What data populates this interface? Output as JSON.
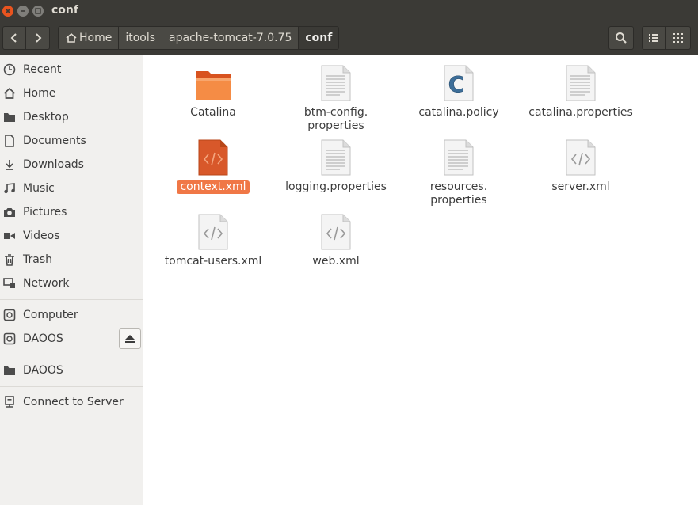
{
  "window": {
    "title": "conf"
  },
  "toolbar": {
    "breadcrumbs": [
      "Home",
      "itools",
      "apache-tomcat-7.0.75",
      "conf"
    ]
  },
  "sidebar": {
    "items": [
      {
        "label": "Recent",
        "icon": "clock-icon"
      },
      {
        "label": "Home",
        "icon": "home-icon"
      },
      {
        "label": "Desktop",
        "icon": "folder-icon"
      },
      {
        "label": "Documents",
        "icon": "document-icon"
      },
      {
        "label": "Downloads",
        "icon": "download-icon"
      },
      {
        "label": "Music",
        "icon": "music-icon"
      },
      {
        "label": "Pictures",
        "icon": "camera-icon"
      },
      {
        "label": "Videos",
        "icon": "video-icon"
      },
      {
        "label": "Trash",
        "icon": "trash-icon"
      },
      {
        "label": "Network",
        "icon": "network-icon"
      },
      {
        "label": "Computer",
        "icon": "drive-icon"
      },
      {
        "label": "DAOOS",
        "icon": "drive-icon"
      },
      {
        "label": "DAOOS",
        "icon": "folder-icon"
      },
      {
        "label": "Connect to Server",
        "icon": "server-icon"
      }
    ]
  },
  "files": [
    {
      "name": "Catalina",
      "type": "folder"
    },
    {
      "name": "btm-config.\nproperties",
      "type": "text"
    },
    {
      "name": "catalina.policy",
      "type": "policy"
    },
    {
      "name": "catalina.properties",
      "type": "text"
    },
    {
      "name": "context.xml",
      "type": "xml-selected"
    },
    {
      "name": "logging.properties",
      "type": "text"
    },
    {
      "name": "resources.\nproperties",
      "type": "text"
    },
    {
      "name": "server.xml",
      "type": "xml"
    },
    {
      "name": "tomcat-users.xml",
      "type": "xml"
    },
    {
      "name": "web.xml",
      "type": "xml"
    }
  ],
  "colors": {
    "accent": "#f07746",
    "titlebar": "#3b3a36",
    "sidebar": "#f1f0ee"
  }
}
